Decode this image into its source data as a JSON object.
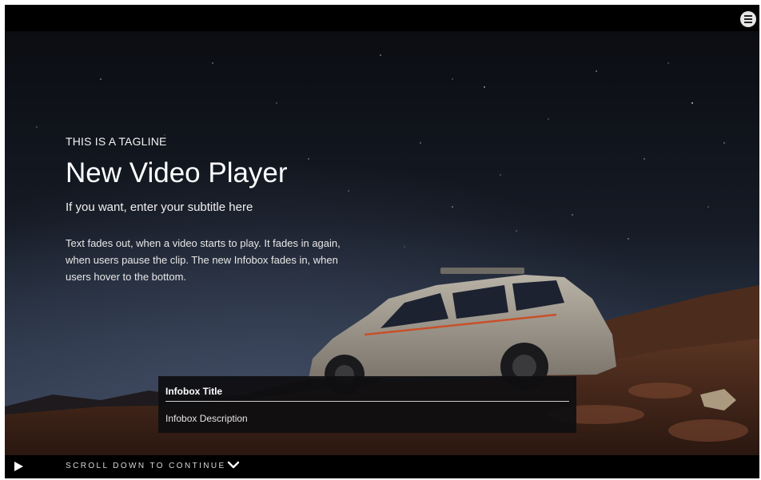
{
  "hero": {
    "tagline": "THIS IS A TAGLINE",
    "title": "New Video Player",
    "subtitle": "If you want, enter your subtitle here",
    "body": "Text fades out, when a video starts to play.  It fades in again, when users pause the clip. The new Infobox fades in, when users hover to the bottom."
  },
  "infobox": {
    "title": "Infobox Title",
    "description": "Infobox Description"
  },
  "controls": {
    "scroll_label": "SCROLL DOWN TO CONTINUE",
    "icons": [
      "menu-icon",
      "play-icon",
      "chevron-down-icon"
    ]
  },
  "colors": {
    "bar": "#000000",
    "sky_top": "#0b0d12",
    "text": "#ffffff"
  }
}
